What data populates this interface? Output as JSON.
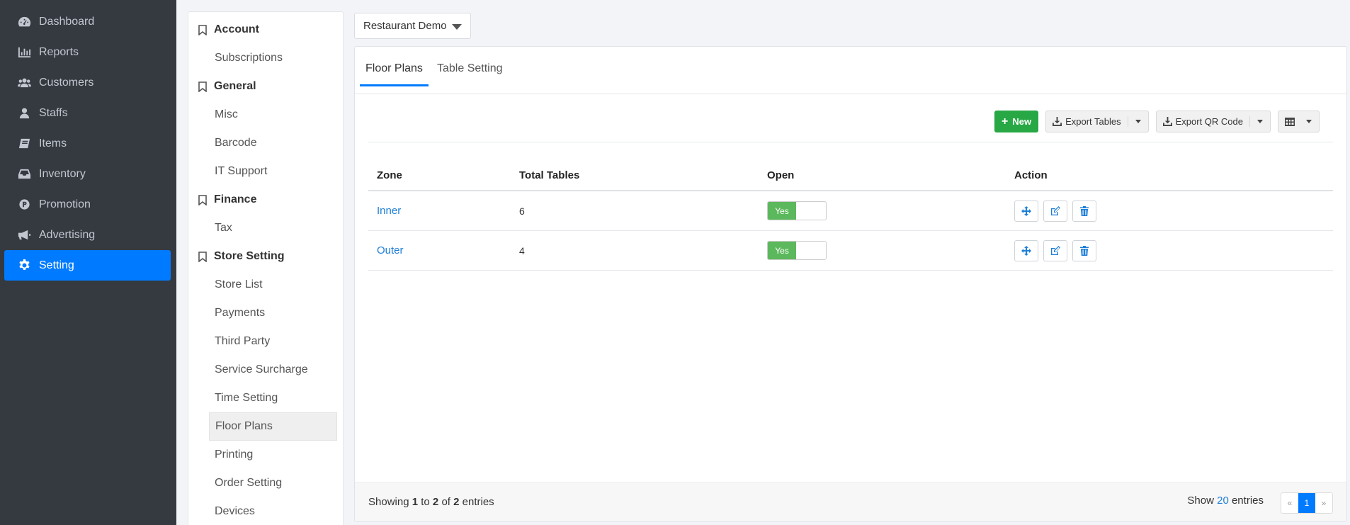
{
  "nav": {
    "items": [
      {
        "label": "Dashboard",
        "icon": "dashboard-icon"
      },
      {
        "label": "Reports",
        "icon": "bar-chart-icon"
      },
      {
        "label": "Customers",
        "icon": "users-icon"
      },
      {
        "label": "Staffs",
        "icon": "user-icon"
      },
      {
        "label": "Items",
        "icon": "book-icon"
      },
      {
        "label": "Inventory",
        "icon": "inbox-icon"
      },
      {
        "label": "Promotion",
        "icon": "promotion-icon"
      },
      {
        "label": "Advertising",
        "icon": "megaphone-icon"
      },
      {
        "label": "Setting",
        "icon": "gear-icon"
      }
    ]
  },
  "settings_menu": {
    "account": "Account",
    "subscriptions": "Subscriptions",
    "general": "General",
    "misc": "Misc",
    "barcode": "Barcode",
    "it_support": "IT Support",
    "finance": "Finance",
    "tax": "Tax",
    "store_setting": "Store Setting",
    "store_list": "Store List",
    "payments": "Payments",
    "third_party": "Third Party",
    "service_surcharge": "Service Surcharge",
    "time_setting": "Time Setting",
    "floor_plans": "Floor Plans",
    "printing": "Printing",
    "order_setting": "Order Setting",
    "devices": "Devices"
  },
  "store_select": {
    "value": "Restaurant Demo"
  },
  "tabs": {
    "floor_plans": "Floor Plans",
    "table_setting": "Table Setting"
  },
  "toolbar": {
    "new_label": "New",
    "export_tables": "Export Tables",
    "export_qr": "Export QR Code"
  },
  "table": {
    "headers": {
      "zone": "Zone",
      "total_tables": "Total Tables",
      "open": "Open",
      "action": "Action"
    },
    "rows": [
      {
        "zone": "Inner",
        "total": "6",
        "open": "Yes"
      },
      {
        "zone": "Outer",
        "total": "4",
        "open": "Yes"
      }
    ]
  },
  "footer": {
    "showing": "Showing",
    "from": "1",
    "to_word": "to",
    "to": "2",
    "of_word": "of",
    "total": "2",
    "entries": "entries",
    "show_label": "Show",
    "page_size": "20",
    "show_entries": "entries",
    "prev": "«",
    "page": "1",
    "next": "»"
  },
  "colors": {
    "sidebar_bg": "#343a40",
    "accent": "#007bff",
    "success": "#28a745",
    "toggle_on": "#5cb85c"
  }
}
